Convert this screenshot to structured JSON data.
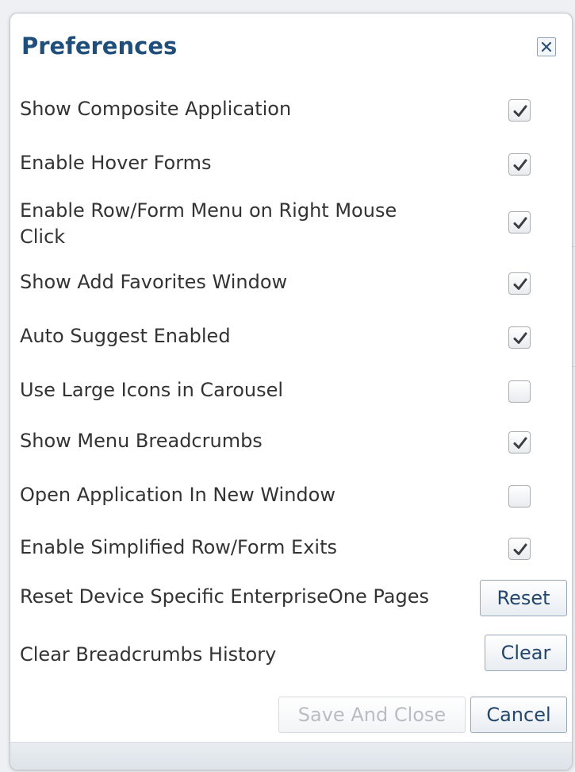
{
  "dialog": {
    "title": "Preferences",
    "close_icon": "close-icon",
    "preferences": [
      {
        "label": "Show Composite Application",
        "checked": true
      },
      {
        "label": "Enable Hover Forms",
        "checked": true
      },
      {
        "label": "Enable Row/Form Menu on Right Mouse Click",
        "checked": true
      },
      {
        "label": "Show Add Favorites Window",
        "checked": true
      },
      {
        "label": "Auto Suggest Enabled",
        "checked": true
      },
      {
        "label": "Use Large Icons in Carousel",
        "checked": false
      },
      {
        "label": "Show Menu Breadcrumbs",
        "checked": true
      },
      {
        "label": "Open Application In New Window",
        "checked": false
      },
      {
        "label": "Enable Simplified Row/Form Exits",
        "checked": true
      }
    ],
    "actions": [
      {
        "label": "Reset Device Specific EnterpriseOne Pages",
        "button": "Reset"
      },
      {
        "label": "Clear Breadcrumbs History",
        "button": "Clear"
      }
    ],
    "save_label": "Save And Close",
    "save_disabled": true,
    "cancel_label": "Cancel"
  },
  "colors": {
    "title": "#1e4e79",
    "button_text": "#24476d",
    "label_text": "#333333"
  }
}
